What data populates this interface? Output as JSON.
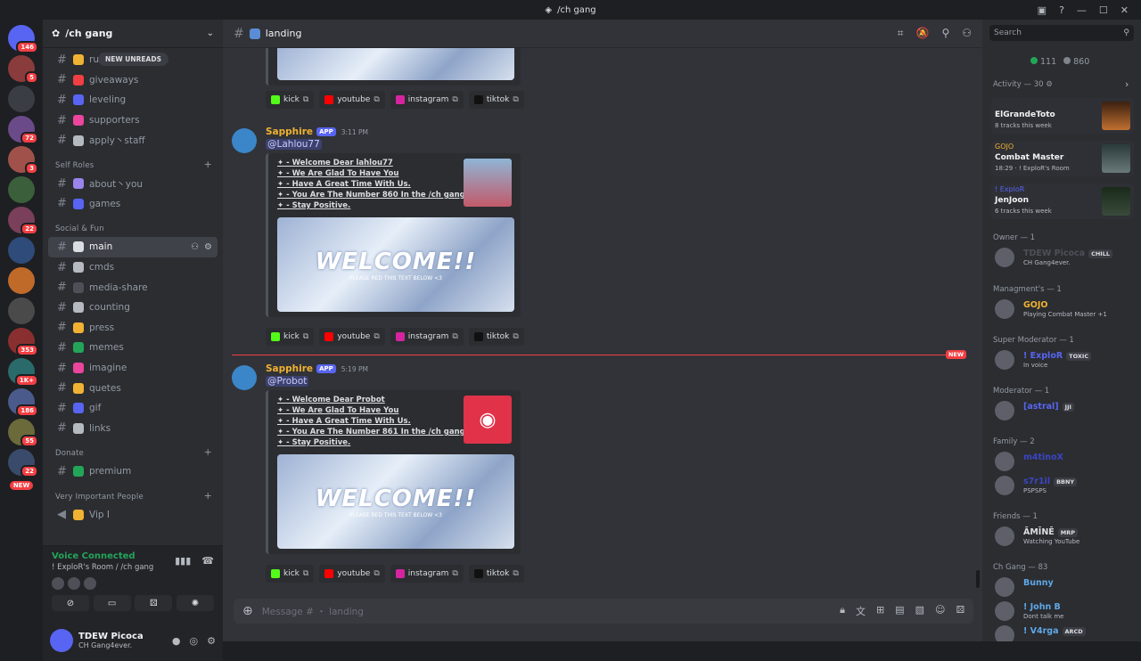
{
  "window": {
    "title": "/ch gang"
  },
  "guild": {
    "name": "/ch gang"
  },
  "rail": {
    "badges": [
      "146",
      "5",
      "72",
      "3",
      "22",
      "353",
      "1K+",
      "186",
      "55",
      "22"
    ],
    "new_label": "NEW"
  },
  "sidebar": {
    "new_unreads": "NEW UNREADS",
    "channels": [
      {
        "name": "ru",
        "color": "#f0b232"
      },
      {
        "name": "giveaways",
        "color": "#f23f43"
      },
      {
        "name": "leveling",
        "color": "#5865f2"
      },
      {
        "name": "supporters",
        "color": "#eb459e"
      },
      {
        "name": "apply丶staff",
        "color": "#b5bac1"
      }
    ],
    "cat_self_roles": "Self Roles",
    "self_roles": [
      {
        "name": "about丶you",
        "color": "#9b84ec"
      },
      {
        "name": "games",
        "color": "#5865f2"
      }
    ],
    "cat_social": "Social & Fun",
    "social": [
      {
        "name": "main",
        "color": "#dbdee1"
      },
      {
        "name": "cmds",
        "color": "#b5bac1"
      },
      {
        "name": "media-share",
        "color": "#4e5058"
      },
      {
        "name": "counting",
        "color": "#b5bac1"
      },
      {
        "name": "press",
        "color": "#f0b232"
      },
      {
        "name": "memes",
        "color": "#23a559"
      },
      {
        "name": "imagine",
        "color": "#eb459e"
      },
      {
        "name": "quetes",
        "color": "#f0b232"
      },
      {
        "name": "gif",
        "color": "#5865f2"
      },
      {
        "name": "links",
        "color": "#b5bac1"
      }
    ],
    "cat_donate": "Donate",
    "donate": [
      {
        "name": "premium",
        "color": "#23a559"
      }
    ],
    "cat_vip": "Very Important People",
    "vip": [
      {
        "name": "Vip I",
        "color": "#f0b232"
      }
    ]
  },
  "voice": {
    "status": "Voice Connected",
    "room": "! ExploR's Room / /ch gang"
  },
  "user": {
    "name": "TDEW Picoca",
    "status": "CH Gang4ever."
  },
  "chat": {
    "channel": "landing",
    "composer_placeholder": "Message #  ・ landing",
    "messages": [
      {
        "author": "Sapphire",
        "app": "APP",
        "time": "3:11 PM",
        "mention": "@Lahlou77",
        "lines": [
          "✦ - Welcome Dear lahlou77",
          "✦ - We Are Glad To Have You",
          "✦ - Have A Great Time With Us.",
          "✦ - You Are The Number 860 In the /ch gang",
          "✦ - Stay Positive."
        ]
      },
      {
        "author": "Sapphire",
        "app": "APP",
        "time": "5:19 PM",
        "mention": "@Probot",
        "lines": [
          "✦ - Welcome Dear Probot",
          "✦ - We Are Glad To Have You",
          "✦ - Have A Great Time With Us.",
          "✦ - You Are The Number 861 In the /ch gang",
          "✦ - Stay Positive."
        ]
      }
    ],
    "banner_title": "WELCOME!!",
    "banner_sub": "PLEASE RED THIS TEXT BELOW <3",
    "links": [
      "kick",
      "youtube",
      "instagram",
      "tiktok"
    ],
    "new_label": "NEW"
  },
  "members": {
    "search_placeholder": "Search",
    "online": "111",
    "total": "860",
    "activity_head": "Activity — 30",
    "activities": [
      {
        "user": "",
        "title": "ElGrandeToto",
        "sub": "8 tracks this week"
      },
      {
        "user": "GOJO",
        "title": "Combat Master",
        "sub": "18:29 · ! ExploR's Room"
      },
      {
        "user": "! ExploR",
        "title": "JenJoon",
        "sub": "6 tracks this week"
      }
    ],
    "groups": [
      {
        "head": "Owner — 1",
        "members": [
          {
            "name": "TDEW Picoca",
            "tag": "CHILL",
            "status": "CH Gang4ever.",
            "color": "#4e5058"
          }
        ]
      },
      {
        "head": "Managment's — 1",
        "members": [
          {
            "name": "GOJO",
            "tag": "",
            "status": "Playing Combat Master +1",
            "color": "#f0b232"
          }
        ]
      },
      {
        "head": "Super Moderator — 1",
        "members": [
          {
            "name": "! ExploR",
            "tag": "TOXIC",
            "status": "In voice",
            "color": "#5865f2"
          }
        ]
      },
      {
        "head": "Moderator — 1",
        "members": [
          {
            "name": "[astral]",
            "tag": "JJI",
            "status": "",
            "color": "#5865f2"
          }
        ]
      },
      {
        "head": "Family — 2",
        "members": [
          {
            "name": "m4tinoX",
            "tag": "",
            "status": "",
            "color": "#3b45c4"
          },
          {
            "name": "s7r1il",
            "tag": "BBNY",
            "status": "PSPSPS",
            "color": "#3b45c4"
          }
        ]
      },
      {
        "head": "Friends — 1",
        "members": [
          {
            "name": "ĀMĪNĒ",
            "tag": "MRP",
            "status": "Watching YouTube",
            "color": "#dbdee1"
          }
        ]
      },
      {
        "head": "Ch Gang — 83",
        "members": [
          {
            "name": "Bunny",
            "tag": "",
            "status": "",
            "color": "#5fa8e8"
          },
          {
            "name": "! John B",
            "tag": "",
            "status": "Dont talk me",
            "color": "#5fa8e8"
          },
          {
            "name": "! V4rga",
            "tag": "ARCD",
            "status": "",
            "color": "#5fa8e8"
          }
        ]
      }
    ]
  }
}
